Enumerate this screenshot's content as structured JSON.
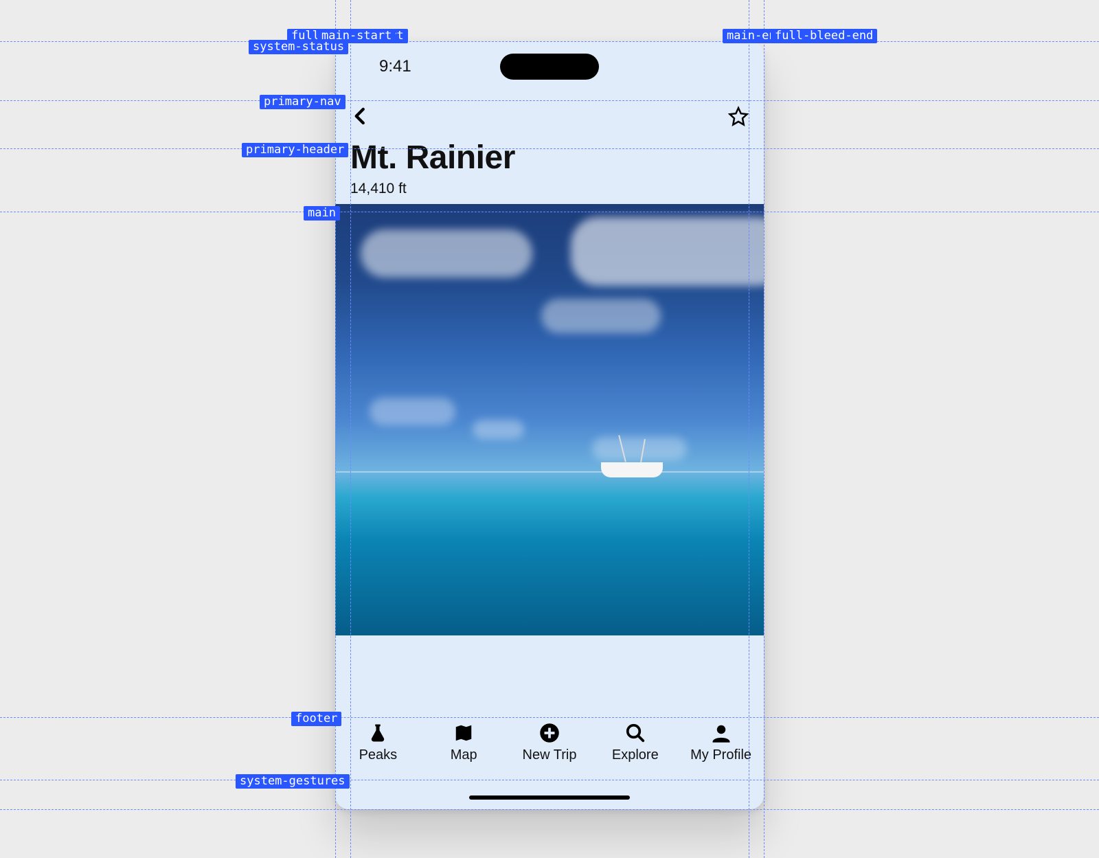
{
  "status": {
    "time": "9:41"
  },
  "header": {
    "title": "Mt. Rainier",
    "subtitle": "14,410 ft"
  },
  "tabs": [
    {
      "label": "Peaks"
    },
    {
      "label": "Map"
    },
    {
      "label": "New Trip"
    },
    {
      "label": "Explore"
    },
    {
      "label": "My Profile"
    }
  ],
  "guides": {
    "full_bleed_start": "full-bleed-start",
    "main_start": "main-start",
    "main_end": "main-end",
    "full_bleed_end": "full-bleed-end",
    "system_status": "system-status",
    "primary_nav": "primary-nav",
    "primary_header": "primary-header",
    "main": "main",
    "footer": "footer",
    "system_gestures": "system-gestures"
  }
}
